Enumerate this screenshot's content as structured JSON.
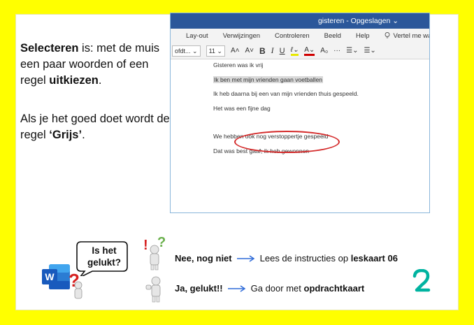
{
  "left_text": {
    "p1_bold1": "Selecteren",
    "p1_text1": " is: met de muis een paar woorden of een regel ",
    "p1_bold2": "uitkiezen",
    "p1_text2": ".",
    "p2_text1": "Als je het goed doet wordt de regel ",
    "p2_bold": "‘Grijs’",
    "p2_text2": "."
  },
  "word": {
    "title": "gisteren - Opgeslagen ⌄",
    "tabs": [
      "Lay-out",
      "Verwijzingen",
      "Controleren",
      "Beeld",
      "Help"
    ],
    "tell_me": "Vertel me wat u w",
    "font_name": "ofdt... ⌄",
    "font_size": "11 ⌄",
    "grow": "A˄",
    "shrink": "A˅",
    "bold": "B",
    "italic": "I",
    "underline": "U",
    "highlight": "ℓ⌄",
    "font_color": "A⌄",
    "clear": "A₀",
    "more": "···",
    "bullets": "☰⌄",
    "numbering": "☰⌄",
    "doc_lines": [
      "Gisteren was ik vrij",
      "Ik ben met mijn vrienden gaan voetballen",
      "Ik heb daarna bij een van mijn vrienden thuis gespeeld.",
      "Het was een fijne dag",
      "",
      "We hebben ook nog verstoppertje gespeeld",
      "Dat was best gaaf; ik heb gewonnen"
    ]
  },
  "bubble": {
    "text": "Is het gelukt?"
  },
  "rows": {
    "no_bold": "Nee, nog niet",
    "no_text": "Lees de instructies op ",
    "no_card": "leskaart 06",
    "yes_bold": "Ja, gelukt!!",
    "yes_text": "Ga door met ",
    "yes_card": "opdrachtkaart"
  },
  "colors": {
    "background": "#ffff00",
    "word_blue": "#2b579a",
    "ellipse": "#d42a2a",
    "arrow": "#2f6bd8",
    "two_green": "#00b3a0"
  }
}
